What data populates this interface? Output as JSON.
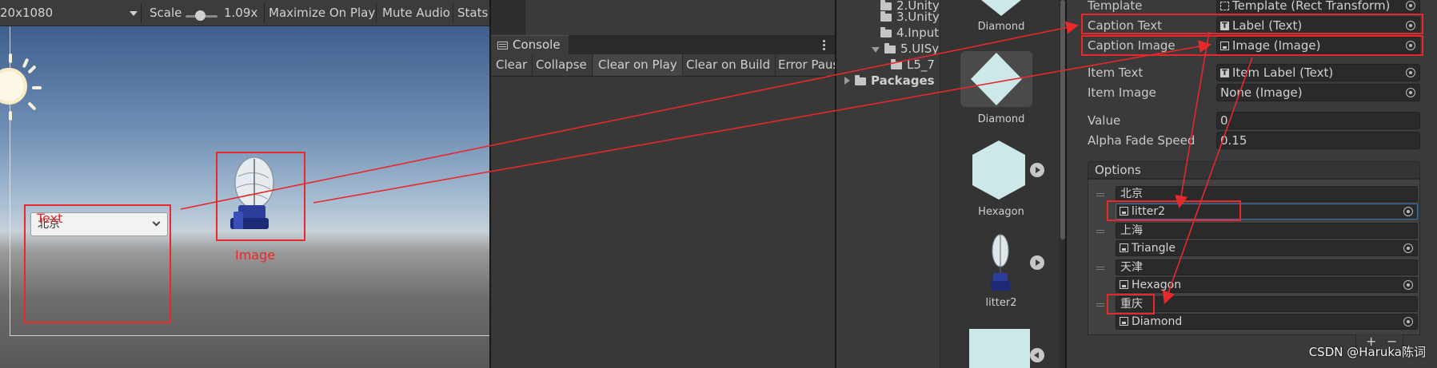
{
  "game": {
    "resolution": "20x1080",
    "scale_label": "Scale",
    "scale_value": "1.09x",
    "maximize_on_play": "Maximize On Play",
    "mute_audio": "Mute Audio",
    "stats": "Stats",
    "dropdown_value": "北京",
    "text_label": "Text",
    "image_label": "Image"
  },
  "console": {
    "tab_label": "Console",
    "buttons": [
      "Clear",
      "Collapse",
      "Clear on Play",
      "Clear on Build",
      "Error Paus"
    ]
  },
  "project": {
    "tree": [
      {
        "label": "2.Unity",
        "indent": 2
      },
      {
        "label": "3.Unity",
        "indent": 2
      },
      {
        "label": "4.Input",
        "indent": 2
      },
      {
        "label": "5.UISy",
        "indent": 1
      },
      {
        "label": "L5_7",
        "indent": 3
      }
    ],
    "packages": "Packages",
    "assets": [
      {
        "name": "Diamond"
      },
      {
        "name": "Diamond"
      },
      {
        "name": "Hexagon"
      },
      {
        "name": "litter2"
      }
    ]
  },
  "inspector": {
    "template": {
      "label": "Template",
      "value": "Template (Rect Transform)"
    },
    "caption_text": {
      "label": "Caption Text",
      "value": "Label (Text)"
    },
    "caption_image": {
      "label": "Caption Image",
      "value": "Image (Image)"
    },
    "item_text": {
      "label": "Item Text",
      "value": "Item Label (Text)"
    },
    "item_image": {
      "label": "Item Image",
      "value": "None (Image)"
    },
    "value": {
      "label": "Value",
      "value": "0"
    },
    "alpha_fade_speed": {
      "label": "Alpha Fade Speed",
      "value": "0.15"
    },
    "options_label": "Options",
    "options": [
      {
        "text": "北京",
        "image": "litter2"
      },
      {
        "text": "上海",
        "image": "Triangle"
      },
      {
        "text": "天津",
        "image": "Hexagon"
      },
      {
        "text": "重庆",
        "image": "Diamond"
      }
    ],
    "plus": "+",
    "minus": "−"
  },
  "watermark": "CSDN @Haruka陈词",
  "colors": {
    "annotation_red": "#e8282b",
    "panel_bg": "#383838",
    "field_bg": "#2a2a2a"
  }
}
